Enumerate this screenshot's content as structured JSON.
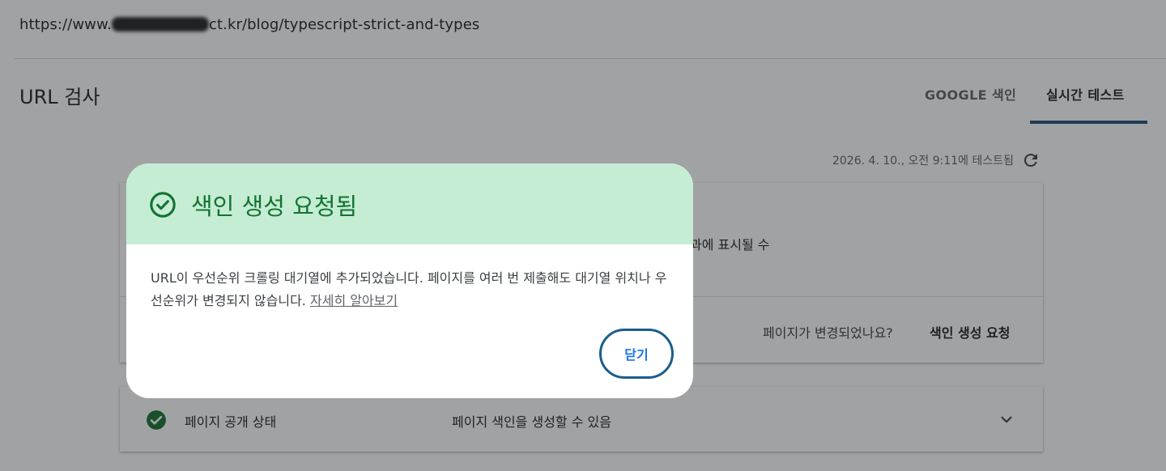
{
  "url_bar": {
    "prefix": "https://www.",
    "suffix": "ct.kr/blog/typescript-strict-and-types"
  },
  "header": {
    "title": "URL 검사",
    "tabs": [
      {
        "label": "GOOGLE 색인",
        "active": false
      },
      {
        "label": "실시간 테스트",
        "active": true
      }
    ],
    "accent_color": "#1f4d78"
  },
  "test_info": {
    "tested_at": "2026. 4. 10., 오전 9:11에 테스트됨",
    "refresh_icon": "refresh-icon"
  },
  "card": {
    "partial_text": "과에 표시될 수",
    "changed_question": "페이지가 변경되었나요?",
    "request_indexing": "색인 생성 요청"
  },
  "status_row": {
    "label": "페이지 공개 상태",
    "value": "페이지 색인을 생성할 수 있음",
    "icon": "check-circle-icon",
    "expand_icon": "chevron-down-icon",
    "status_color": "#137333"
  },
  "dialog": {
    "title": "색인 생성 요청됨",
    "header_color": "#c5edd3",
    "title_color": "#137333",
    "body": "URL이 우선순위 크롤링 대기열에 추가되었습니다. 페이지를 여러 번 제출해도 대기열 위치나 우선순위가 변경되지 않습니다.",
    "learn_more": "자세히 알아보기",
    "close_label": "닫기"
  }
}
